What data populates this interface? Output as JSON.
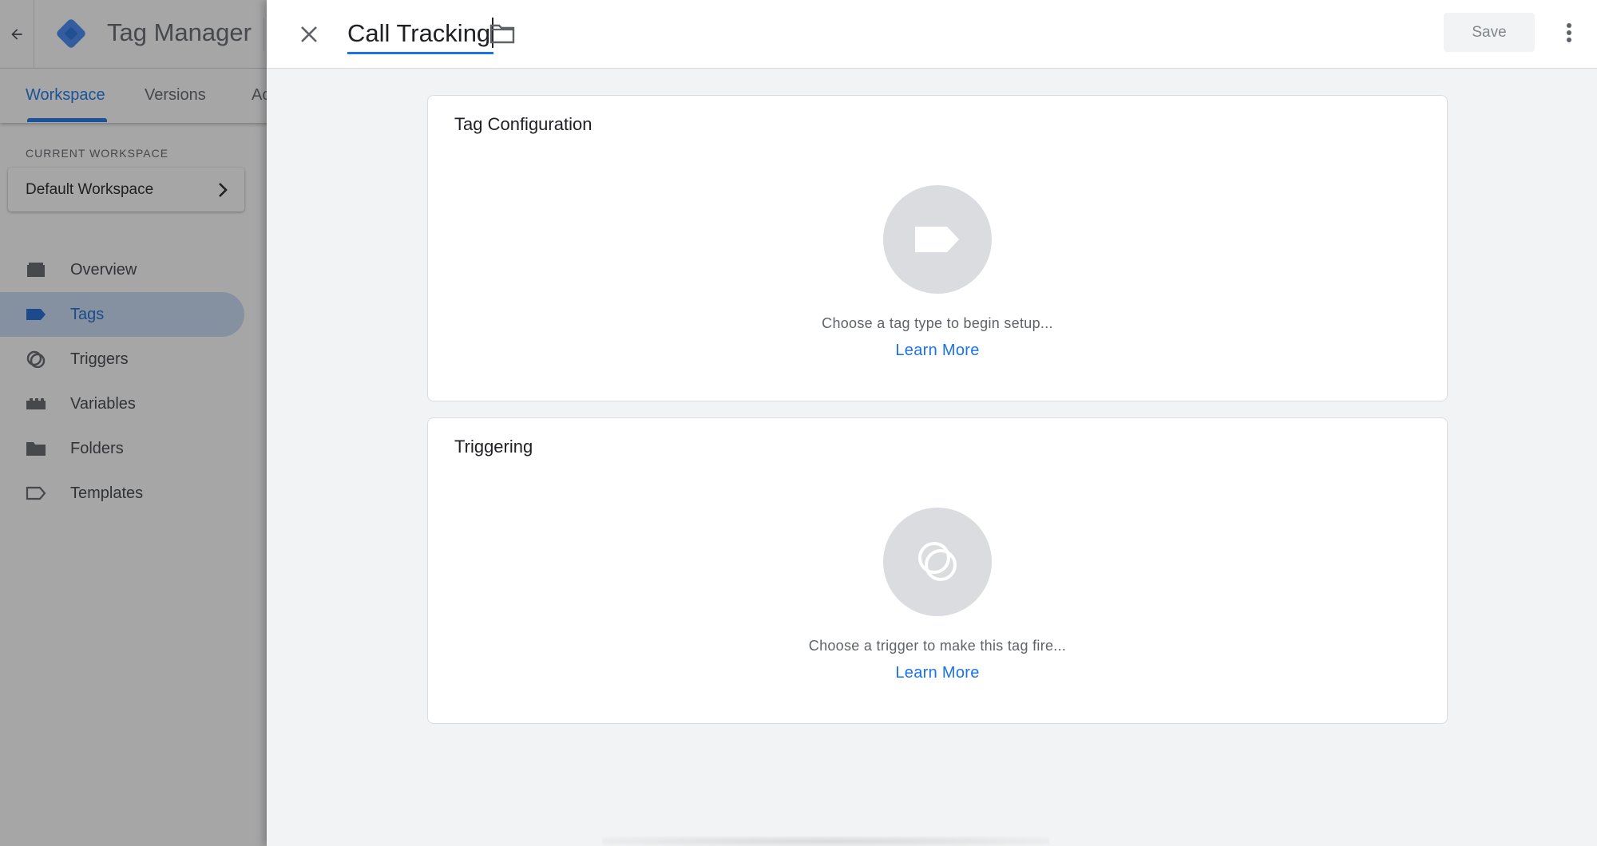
{
  "app": {
    "title": "Tag Manager",
    "brand_color": "#4285f4",
    "accent_color": "#1a73e8"
  },
  "tabs": [
    {
      "label": "Workspace",
      "active": true
    },
    {
      "label": "Versions",
      "active": false
    },
    {
      "label": "Ac",
      "active": false
    }
  ],
  "workspace": {
    "section_label": "CURRENT WORKSPACE",
    "name": "Default Workspace"
  },
  "nav": [
    {
      "label": "Overview",
      "icon": "briefcase-icon",
      "active": false
    },
    {
      "label": "Tags",
      "icon": "tag-icon",
      "active": true
    },
    {
      "label": "Triggers",
      "icon": "trigger-icon",
      "active": false
    },
    {
      "label": "Variables",
      "icon": "variables-icon",
      "active": false
    },
    {
      "label": "Folders",
      "icon": "folder-icon",
      "active": false
    },
    {
      "label": "Templates",
      "icon": "template-icon",
      "active": false
    }
  ],
  "panel": {
    "tag_name": "Call Tracking",
    "save_label": "Save",
    "tag_config": {
      "title": "Tag Configuration",
      "hint": "Choose a tag type to begin setup...",
      "link": "Learn More"
    },
    "triggering": {
      "title": "Triggering",
      "hint": "Choose a trigger to make this tag fire...",
      "link": "Learn More"
    }
  }
}
